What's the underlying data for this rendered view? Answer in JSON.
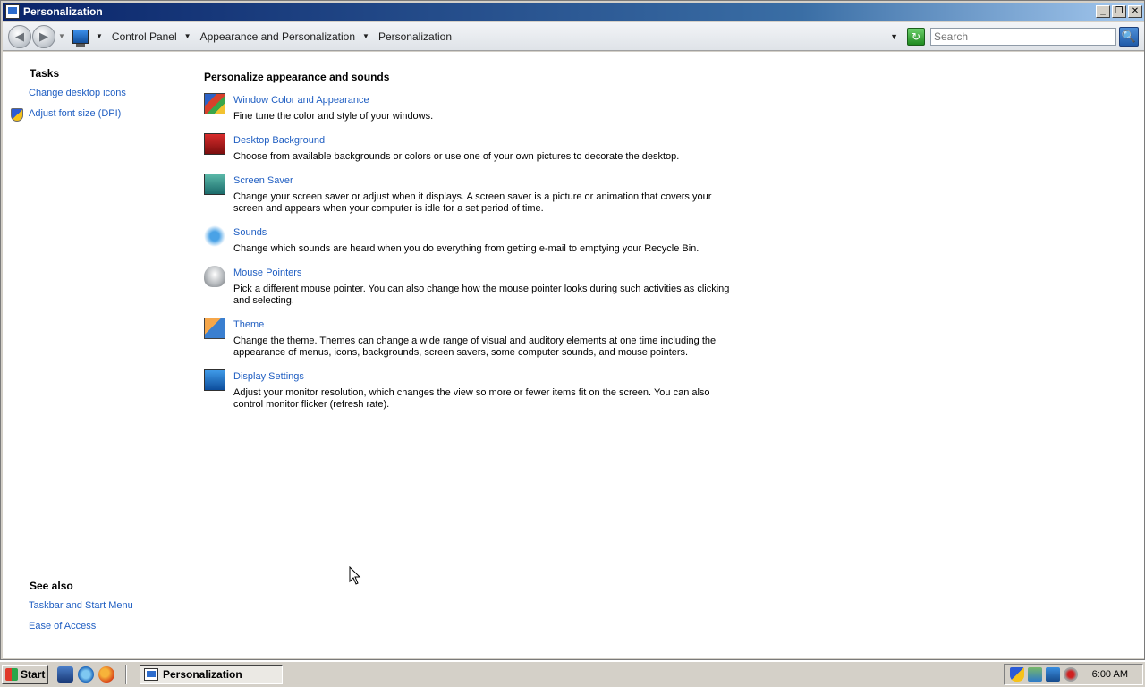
{
  "window": {
    "title": "Personalization",
    "controls": {
      "minimize": "_",
      "restore": "❐",
      "close": "✕"
    }
  },
  "navbar": {
    "back_glyph": "◀",
    "forward_glyph": "▶",
    "breadcrumbs": [
      "Control Panel",
      "Appearance and Personalization",
      "Personalization"
    ],
    "search_placeholder": "Search",
    "refresh_glyph": "↻",
    "search_glyph": "🔍"
  },
  "sidebar": {
    "tasks_heading": "Tasks",
    "tasks": [
      {
        "label": "Change desktop icons"
      },
      {
        "label": "Adjust font size (DPI)"
      }
    ],
    "see_also_heading": "See also",
    "see_also": [
      {
        "label": "Taskbar and Start Menu"
      },
      {
        "label": "Ease of Access"
      }
    ]
  },
  "main": {
    "heading": "Personalize appearance and sounds",
    "items": [
      {
        "icon": "window-color-icon",
        "title": "Window Color and Appearance",
        "description": "Fine tune the color and style of your windows."
      },
      {
        "icon": "desktop-background-icon",
        "title": "Desktop Background",
        "description": "Choose from available backgrounds or colors or use one of your own pictures to decorate the desktop."
      },
      {
        "icon": "screen-saver-icon",
        "title": "Screen Saver",
        "description": "Change your screen saver or adjust when it displays. A screen saver is a picture or animation that covers your screen and appears when your computer is idle for a set period of time."
      },
      {
        "icon": "sounds-icon",
        "title": "Sounds",
        "description": "Change which sounds are heard when you do everything from getting e-mail to emptying your Recycle Bin."
      },
      {
        "icon": "mouse-pointers-icon",
        "title": "Mouse Pointers",
        "description": "Pick a different mouse pointer. You can also change how the mouse pointer looks during such activities as clicking and selecting."
      },
      {
        "icon": "theme-icon",
        "title": "Theme",
        "description": "Change the theme. Themes can change a wide range of visual and auditory elements at one time including the appearance of menus, icons, backgrounds, screen savers, some computer sounds, and mouse pointers."
      },
      {
        "icon": "display-settings-icon",
        "title": "Display Settings",
        "description": "Adjust your monitor resolution, which changes the view so more or fewer items fit on the screen. You can also control monitor flicker (refresh rate)."
      }
    ]
  },
  "taskbar": {
    "start_label": "Start",
    "task_label": "Personalization",
    "clock": "6:00 AM"
  },
  "colors": {
    "link": "#1f5ec2",
    "titlebar_start": "#0a246a",
    "titlebar_end": "#a6caf0"
  }
}
